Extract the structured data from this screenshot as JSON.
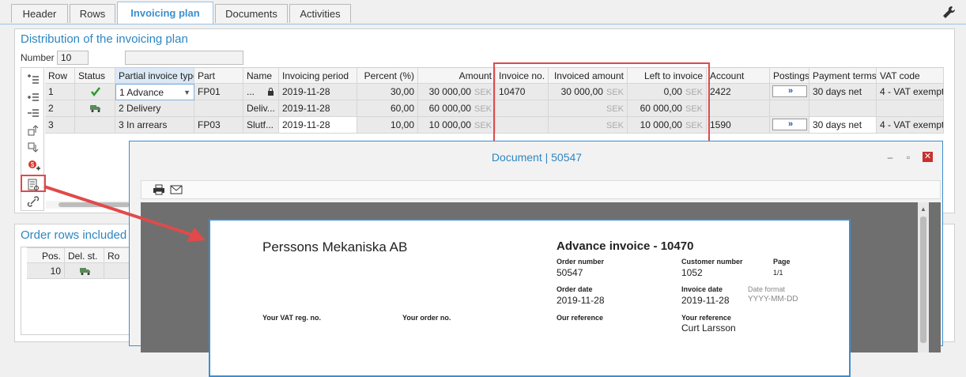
{
  "tabs": [
    "Header",
    "Rows",
    "Invoicing plan",
    "Documents",
    "Activities"
  ],
  "active_tab": "Invoicing plan",
  "invoicing_panel": {
    "title": "Distribution of the invoicing plan",
    "number_label": "Number",
    "number_value": "10",
    "second_value": ""
  },
  "grid": {
    "headers": [
      "Row",
      "Status",
      "Partial invoice type",
      "Part",
      "Name",
      "Invoicing period",
      "Percent (%)",
      "Amount",
      "Invoice no.",
      "Invoiced amount",
      "Left to invoice",
      "Account",
      "Postings",
      "Payment terms",
      "VAT code"
    ],
    "currency": "SEK",
    "rows": [
      {
        "row": "1",
        "status": "check",
        "type": "1 Advance",
        "part": "FP01",
        "name": "...",
        "period": "2019-11-28",
        "percent": "30,00",
        "amount": "30 000,00",
        "invoice_no": "10470",
        "invoiced": "30 000,00",
        "left": "0,00",
        "account": "2422",
        "postings": "»",
        "terms": "30 days net",
        "vat": "4 - VAT exempt"
      },
      {
        "row": "2",
        "status": "truck",
        "type": "2 Delivery",
        "part": "",
        "name": "Deliv...",
        "period": "2019-11-28",
        "percent": "60,00",
        "amount": "60 000,00",
        "invoice_no": "",
        "invoiced": "",
        "left": "60 000,00",
        "account": "",
        "postings": "",
        "terms": "",
        "vat": ""
      },
      {
        "row": "3",
        "status": "",
        "type": "3 In arrears",
        "part": "FP03",
        "name": "Slutf...",
        "period": "2019-11-28",
        "percent": "10,00",
        "amount": "10 000,00",
        "invoice_no": "",
        "invoiced": "",
        "left": "10 000,00",
        "account": "1590",
        "postings": "»",
        "terms": "30 days net",
        "vat": "4 - VAT exempt"
      }
    ]
  },
  "order_rows_panel": {
    "title": "Order rows included i",
    "headers": [
      "Pos.",
      "Del. st.",
      "Ro"
    ],
    "row": {
      "pos": "10"
    }
  },
  "document_window": {
    "title": "Document | 50547",
    "company": "Perssons Mekaniska AB",
    "doc_title": "Advance invoice - 10470",
    "order_number_label": "Order number",
    "order_number": "50547",
    "customer_number_label": "Customer number",
    "customer_number": "1052",
    "page_label": "Page",
    "page": "1/1",
    "order_date_label": "Order date",
    "order_date": "2019-11-28",
    "invoice_date_label": "Invoice date",
    "invoice_date": "2019-11-28",
    "date_format_label": "Date format",
    "date_format": "YYYY-MM-DD",
    "vat_reg_label": "Your VAT reg. no.",
    "your_order_label": "Your order no.",
    "our_ref_label": "Our reference",
    "your_ref_label": "Your reference",
    "your_ref": "Curt Larsson"
  },
  "colors": {
    "accent": "#2e86c1",
    "highlight": "#e04a4a",
    "selected_header": "#dbe8f5"
  }
}
